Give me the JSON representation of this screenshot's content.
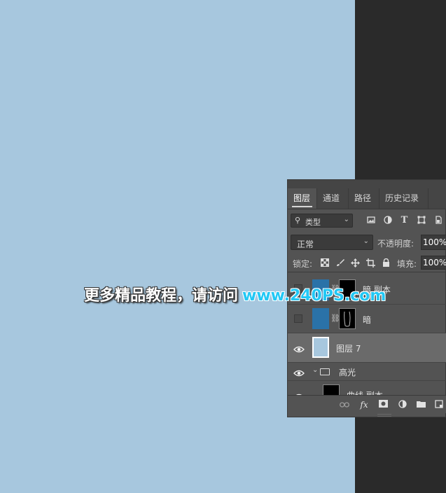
{
  "watermark": {
    "cn_text": "更多精品教程，请访问",
    "url_text": "www.240PS.com"
  },
  "panel": {
    "tabs": [
      {
        "label": "图层",
        "active": true
      },
      {
        "label": "通道",
        "active": false
      },
      {
        "label": "路径",
        "active": false
      },
      {
        "label": "历史记录",
        "active": false
      }
    ],
    "filter": {
      "selected": "类型",
      "icons": [
        "image-filter-icon",
        "adjustment-filter-icon",
        "type-filter-icon",
        "shape-filter-icon",
        "smart-object-filter-icon"
      ]
    },
    "blend_mode": "正常",
    "opacity_label": "不透明度:",
    "opacity_value": "100%",
    "lock_label": "锁定:",
    "fill_label": "填充:",
    "fill_value": "100%",
    "layers": [
      {
        "name": "暗 副本",
        "visible": false,
        "selected": false,
        "thumb_color": "#2a72a8",
        "has_mask": true
      },
      {
        "name": "暗",
        "visible": false,
        "selected": false,
        "thumb_color": "#2a72a8",
        "has_mask": true
      },
      {
        "name": "图层 7",
        "visible": true,
        "selected": true,
        "thumb_color": "#a7c7de",
        "has_mask": false
      },
      {
        "name": "高光",
        "visible": true,
        "selected": false,
        "is_group": true
      },
      {
        "name": "曲线 副本",
        "visible": true,
        "selected": false,
        "has_mask": true
      }
    ],
    "bottom_icons": [
      "link-layers-icon",
      "fx-icon",
      "add-mask-icon",
      "adjustment-layer-icon",
      "new-group-icon",
      "new-layer-icon"
    ]
  },
  "colors": {
    "canvas": "#a7c7de",
    "workspace": "#2a2a2a",
    "panel": "#535353",
    "selected_row": "#6a6a6a",
    "url_accent": "#22c8f5"
  }
}
